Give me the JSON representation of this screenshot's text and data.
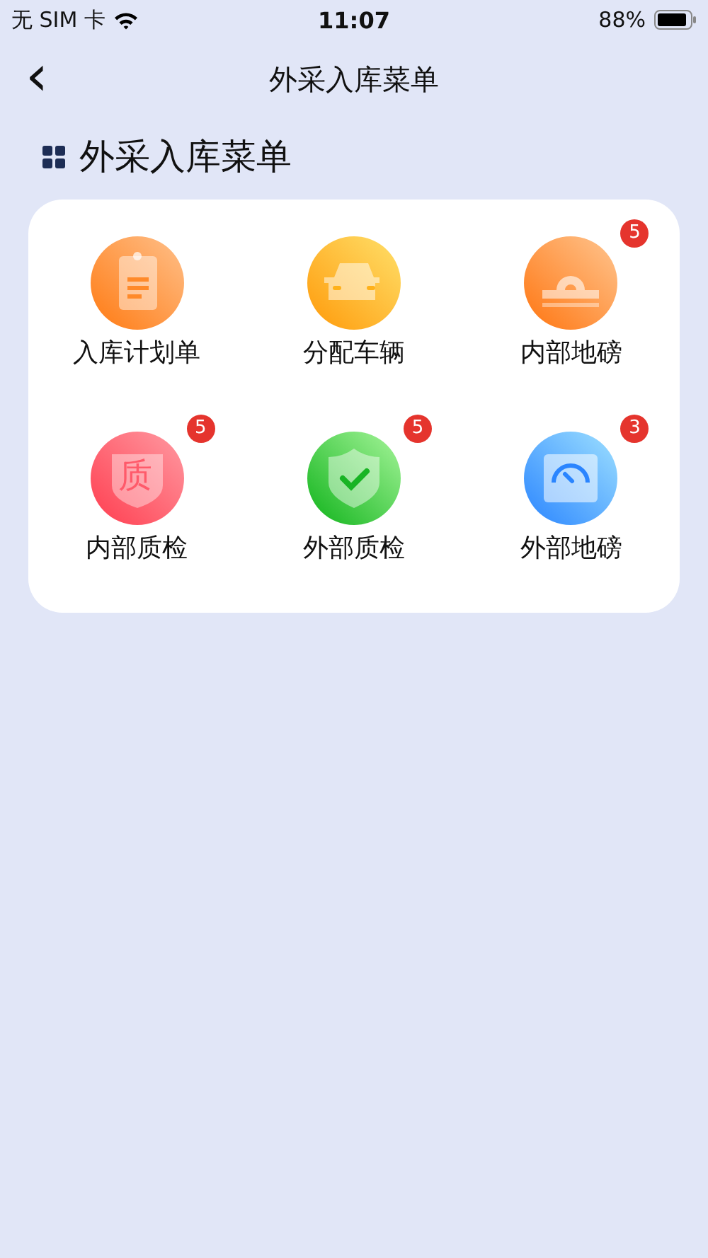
{
  "status_bar": {
    "carrier": "无 SIM 卡",
    "time": "11:07",
    "battery": "88%"
  },
  "nav": {
    "back": "‹",
    "title": "外采入库菜单"
  },
  "section": {
    "title": "外采入库菜单"
  },
  "menu": [
    {
      "kind": "clipboard",
      "label": "入库计划单"
    },
    {
      "kind": "car",
      "label": "分配车辆"
    },
    {
      "kind": "scale",
      "label": "内部地磅",
      "badge": "5"
    },
    {
      "kind": "quality",
      "label": "内部质检",
      "badge": "5",
      "glyph": "质"
    },
    {
      "kind": "check",
      "label": "外部质检",
      "badge": "5"
    },
    {
      "kind": "gauge",
      "label": "外部地磅",
      "badge": "3"
    }
  ]
}
